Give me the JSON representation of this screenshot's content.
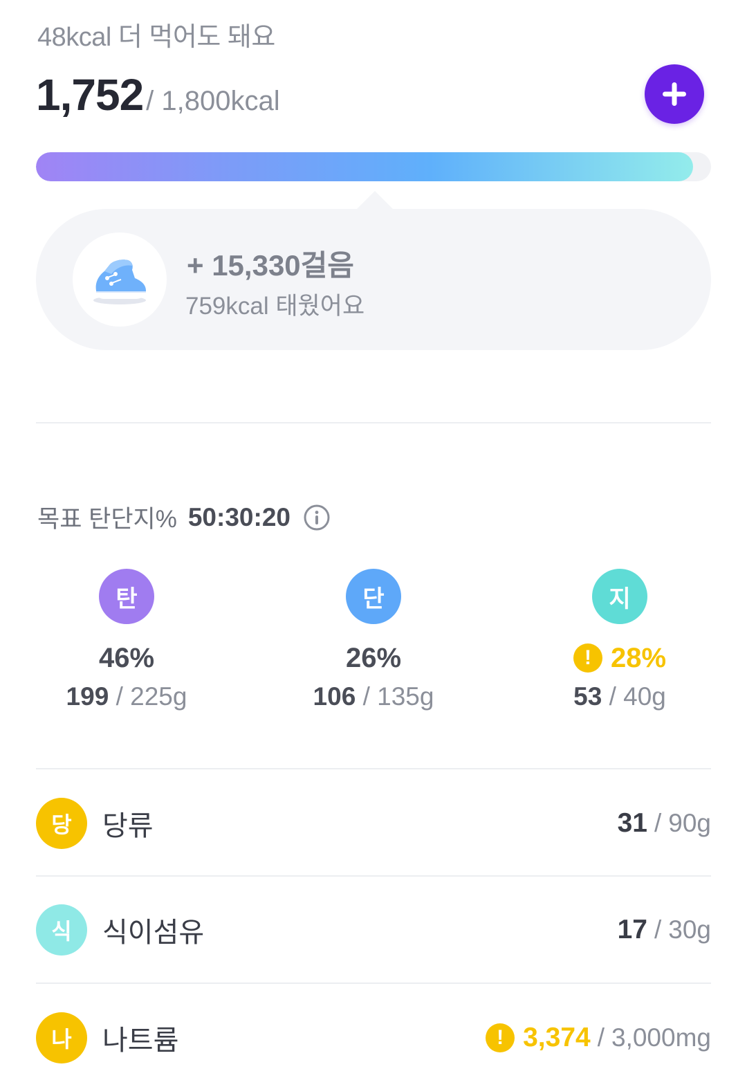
{
  "calories": {
    "remaining_text": "48kcal 더 먹어도 돼요",
    "consumed": "1,752",
    "goal": "/ 1,800kcal",
    "progress_fraction": 0.973
  },
  "steps": {
    "title": "+ 15,330걸음",
    "burned": "759kcal 태웠어요"
  },
  "macros": {
    "goal_label": "목표 탄단지%",
    "goal_ratio": "50:30:20",
    "items": [
      {
        "badge": "탄",
        "color": "#a07cf0",
        "pct": "46%",
        "current": "199",
        "goal": "225g",
        "warning": false
      },
      {
        "badge": "단",
        "color": "#5ea8f9",
        "pct": "26%",
        "current": "106",
        "goal": "135g",
        "warning": false
      },
      {
        "badge": "지",
        "color": "#5fdcd6",
        "pct": "28%",
        "current": "53",
        "goal": "40g",
        "warning": true,
        "warn_symbol": "!"
      }
    ]
  },
  "nutrients": [
    {
      "badge": "당",
      "color": "#f7c300",
      "label": "당류",
      "current": "31",
      "goal": "90g",
      "warning": false
    },
    {
      "badge": "식",
      "color": "#8fe9e6",
      "label": "식이섬유",
      "current": "17",
      "goal": "30g",
      "warning": false
    },
    {
      "badge": "나",
      "color": "#f7c300",
      "label": "나트륨",
      "current": "3,374",
      "goal": "3,000mg",
      "warning": true,
      "warn_symbol": "!"
    }
  ],
  "separator": "/",
  "icons": {
    "add": "plus-icon",
    "shoe": "sneaker-icon",
    "info": "info-icon",
    "warning": "warning-icon"
  }
}
